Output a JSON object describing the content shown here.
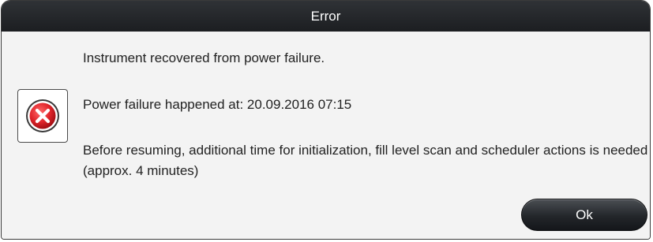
{
  "dialog": {
    "title": "Error",
    "messages": [
      "Instrument recovered from power failure.",
      "Power failure happened at: 20.09.2016 07:15",
      "Before resuming, additional time for initialization, fill level scan and scheduler actions is needed (approx. 4 minutes)"
    ],
    "icon": "error-icon",
    "ok_label": "Ok"
  },
  "colors": {
    "titlebar": "#1c1e21",
    "error_red": "#d9262b",
    "button": "#23262a"
  }
}
